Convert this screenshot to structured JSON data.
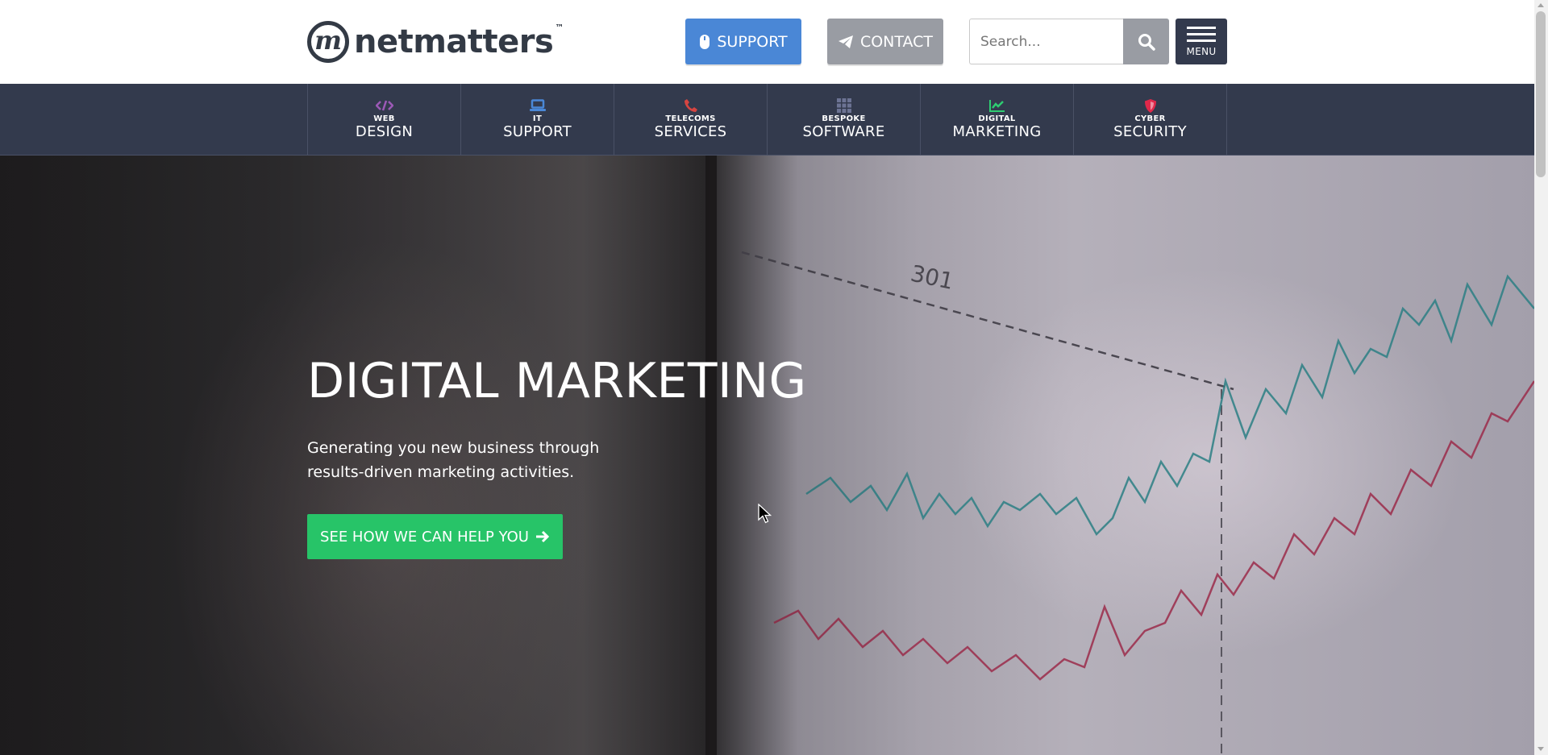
{
  "header": {
    "logo_letter": "m",
    "logo_text": "netmatters",
    "logo_tm": "™",
    "support_label": "SUPPORT",
    "contact_label": "CONTACT",
    "search_placeholder": "Search...",
    "menu_label": "MENU"
  },
  "nav": {
    "items": [
      {
        "small": "WEB",
        "big": "DESIGN",
        "icon": "code-icon",
        "color": "#9b59b6"
      },
      {
        "small": "IT",
        "big": "SUPPORT",
        "icon": "laptop-icon",
        "color": "#4a87d6"
      },
      {
        "small": "TELECOMS",
        "big": "SERVICES",
        "icon": "phone-icon",
        "color": "#d64541"
      },
      {
        "small": "BESPOKE",
        "big": "SOFTWARE",
        "icon": "grid-icon",
        "color": "#6c7393"
      },
      {
        "small": "DIGITAL",
        "big": "MARKETING",
        "icon": "chart-icon",
        "color": "#2ecc71"
      },
      {
        "small": "CYBER",
        "big": "SECURITY",
        "icon": "shield-icon",
        "color": "#e0284a"
      }
    ]
  },
  "hero": {
    "title": "DIGITAL MARKETING",
    "text": "Generating you new business through results-driven marketing activities.",
    "cta_label": "SEE HOW WE CAN HELP YOU",
    "chart_number": "301"
  },
  "colors": {
    "support": "#4a87d6",
    "contact": "#999ca3",
    "nav_bg": "#333a4d",
    "cta": "#27c468"
  }
}
